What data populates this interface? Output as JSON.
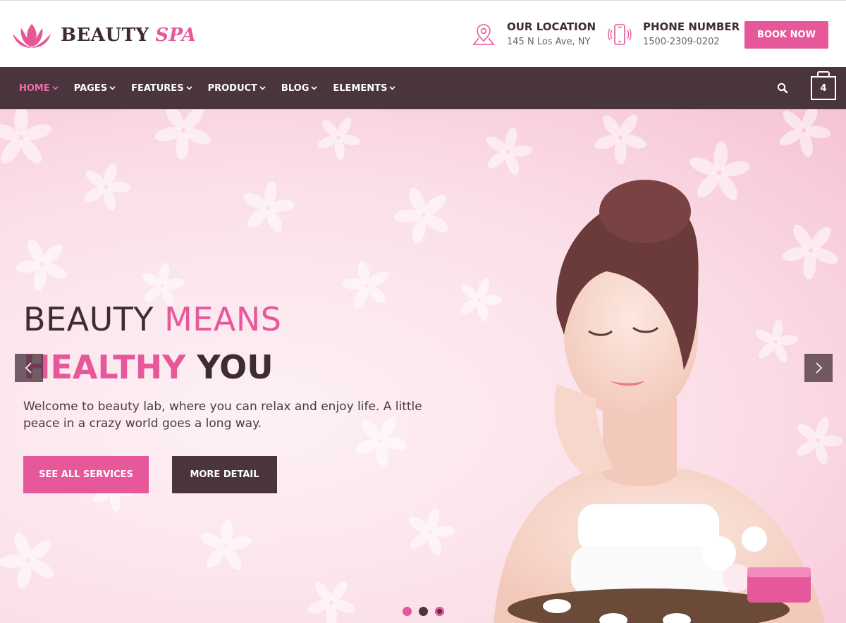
{
  "brand": {
    "word1": "BEAUTY",
    "word2": "SPA",
    "icon": "lotus-icon",
    "accent_color": "#e7589a",
    "dark_color": "#4a353f"
  },
  "header": {
    "location": {
      "title": "OUR LOCATION",
      "value": "145 N Los Ave, NY",
      "icon": "map-pin-icon"
    },
    "phone": {
      "title": "PHONE NUMBER",
      "value": "1500-2309-0202",
      "icon": "mobile-phone-icon"
    },
    "book_label": "BOOK NOW"
  },
  "nav": {
    "items": [
      {
        "label": "HOME",
        "active": true
      },
      {
        "label": "PAGES"
      },
      {
        "label": "FEATURES"
      },
      {
        "label": "PRODUCT"
      },
      {
        "label": "BLOG"
      },
      {
        "label": "ELEMENTS"
      }
    ],
    "search_icon": "search-icon",
    "cart_icon": "shopping-bag-icon",
    "cart_count": "4"
  },
  "hero": {
    "heading1_a": "BEAUTY",
    "heading1_b": "MEANS",
    "heading2_a": "HEALTHY",
    "heading2_b": "YOU",
    "description": "Welcome to beauty lab, where you can relax and enjoy life. A little peace in a crazy world goes a long way.",
    "primary_button": "SEE ALL SERVICES",
    "secondary_button": "MORE DETAIL",
    "prev_icon": "chevron-left-icon",
    "next_icon": "chevron-right-icon",
    "slide_count": 3,
    "active_slide": 1
  }
}
